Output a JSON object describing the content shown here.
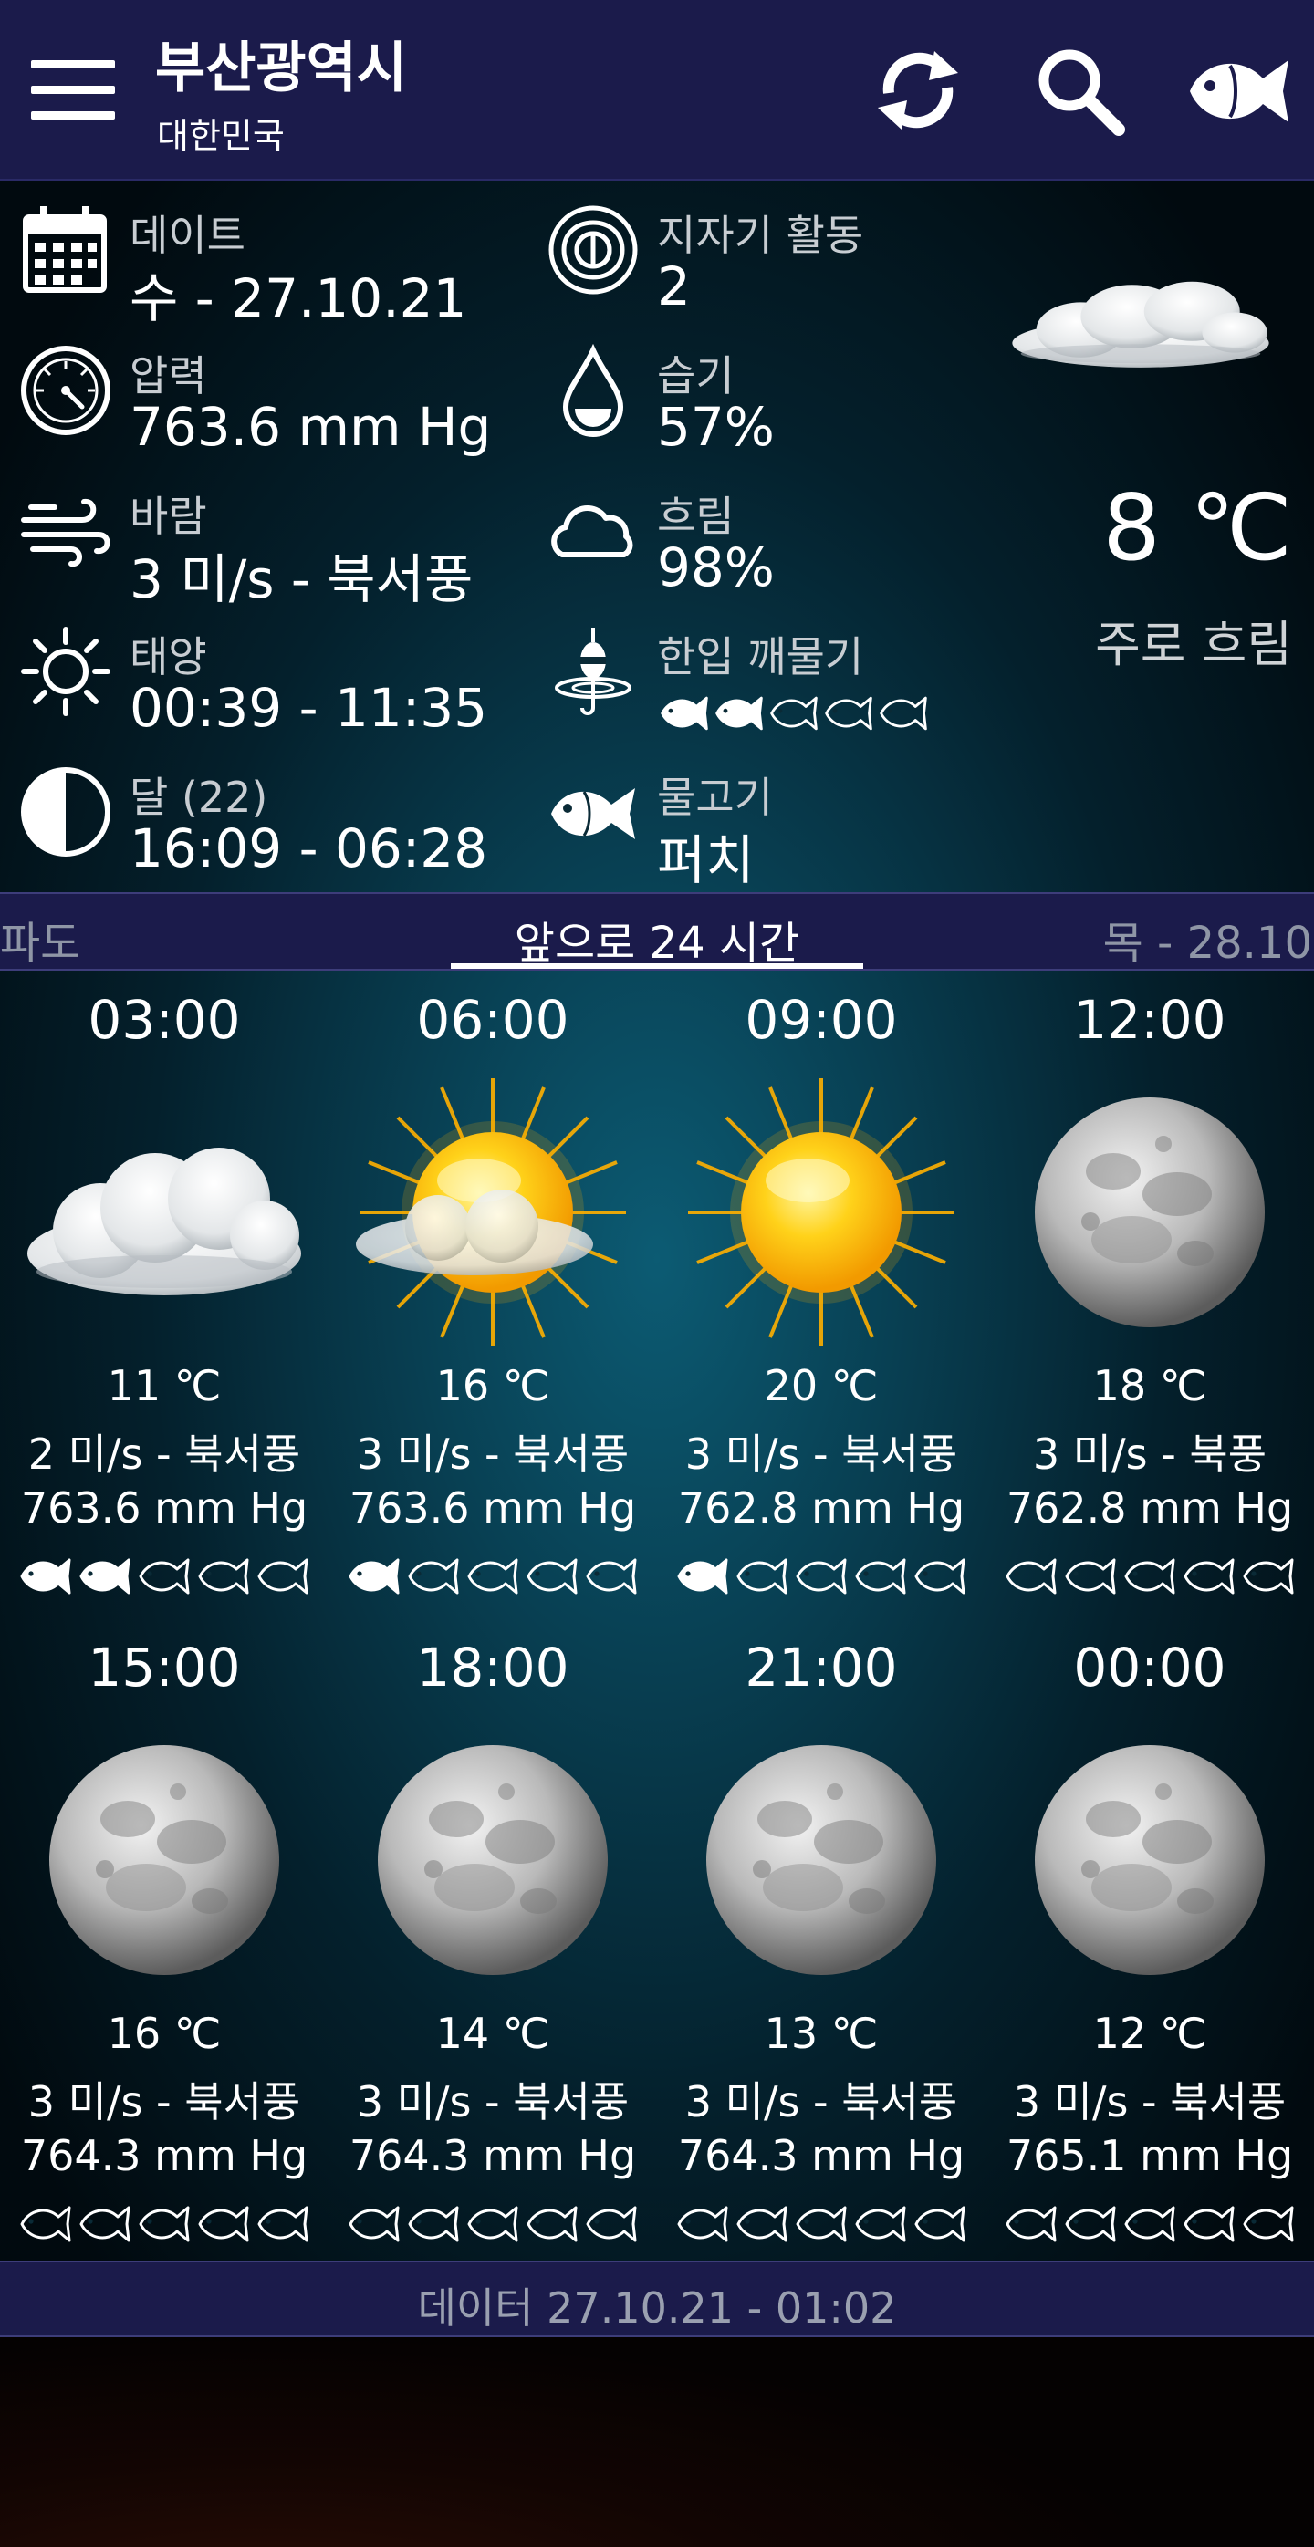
{
  "header": {
    "city": "부산광역시",
    "country": "대한민국",
    "icons": [
      "menu-icon",
      "refresh-icon",
      "search-icon",
      "fish-icon"
    ]
  },
  "info": {
    "date": {
      "label": "데이트",
      "value": "수 - 27.10.21",
      "icon": "calendar-icon"
    },
    "geomagnetic": {
      "label": "지자기 활동",
      "value": "2",
      "icon": "geomagnetic-icon"
    },
    "pressure": {
      "label": "압력",
      "value": "763.6 mm Hg",
      "icon": "barometer-icon"
    },
    "humidity": {
      "label": "습기",
      "value": "57%",
      "icon": "water-drop-icon"
    },
    "wind": {
      "label": "바람",
      "value": "3 미/s - 북서풍",
      "icon": "wind-icon"
    },
    "cloudiness": {
      "label": "흐림",
      "value": "98%",
      "icon": "cloud-icon"
    },
    "sun": {
      "label": "태양",
      "value": "00:39 - 11:35",
      "icon": "sun-icon"
    },
    "bite": {
      "label": "한입 깨물기",
      "rating": 2,
      "max": 5,
      "icon": "fishing-float-icon"
    },
    "moon": {
      "label": "달 (22)",
      "value": "16:09 - 06:28",
      "icon": "moon-phase-icon"
    },
    "fish": {
      "label": "물고기",
      "value": "퍼치",
      "icon": "fish-icon"
    }
  },
  "current": {
    "temperature": "8 ℃",
    "condition": "주로 흐림",
    "icon": "cloudy-icon"
  },
  "tabs": {
    "left": "파도",
    "center": "앞으로 24 시간",
    "right": "목 - 28.10"
  },
  "forecast": [
    {
      "time": "03:00",
      "icon": "cloudy",
      "temp": "11 ℃",
      "wind": "2 미/s - 북서풍",
      "pressure": "763.6 mm Hg",
      "bite": 2
    },
    {
      "time": "06:00",
      "icon": "sun-cloud",
      "temp": "16 ℃",
      "wind": "3 미/s - 북서풍",
      "pressure": "763.6 mm Hg",
      "bite": 1
    },
    {
      "time": "09:00",
      "icon": "sun",
      "temp": "20 ℃",
      "wind": "3 미/s - 북서풍",
      "pressure": "762.8 mm Hg",
      "bite": 1
    },
    {
      "time": "12:00",
      "icon": "moon",
      "temp": "18 ℃",
      "wind": "3 미/s - 북풍",
      "pressure": "762.8 mm Hg",
      "bite": 0
    },
    {
      "time": "15:00",
      "icon": "moon",
      "temp": "16 ℃",
      "wind": "3 미/s - 북서풍",
      "pressure": "764.3 mm Hg",
      "bite": 0
    },
    {
      "time": "18:00",
      "icon": "moon",
      "temp": "14 ℃",
      "wind": "3 미/s - 북서풍",
      "pressure": "764.3 mm Hg",
      "bite": 0
    },
    {
      "time": "21:00",
      "icon": "moon",
      "temp": "13 ℃",
      "wind": "3 미/s - 북서풍",
      "pressure": "764.3 mm Hg",
      "bite": 0
    },
    {
      "time": "00:00",
      "icon": "moon",
      "temp": "12 ℃",
      "wind": "3 미/s - 북서풍",
      "pressure": "765.1 mm Hg",
      "bite": 0
    }
  ],
  "footer": {
    "updated": "데이터 27.10.21 - 01:02"
  },
  "colors": {
    "app_bar": "#1b1b4b",
    "label_text": "#c8cdd2",
    "muted_tab": "#8f96a6",
    "sun": "#ffc400"
  }
}
